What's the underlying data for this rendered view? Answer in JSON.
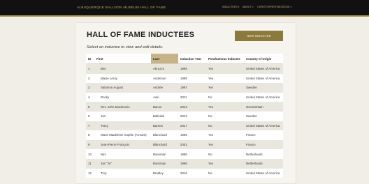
{
  "nav": {
    "brand": "ALBUQUERQUE BALLOON MUSEUM HALL OF FAME",
    "menus": [
      "INDUCTEES",
      "ABOUT",
      "CHRISTOPHER BELROSE"
    ]
  },
  "page": {
    "title": "HALL OF FAME INDUCTEES",
    "new_button": "NEW INDUCTEE",
    "hint": "Select an inductee to view and edit details."
  },
  "table": {
    "columns": [
      "ID",
      "First",
      "Last",
      "Induction Year",
      "Posthumous Inductee",
      "Country of Origin"
    ],
    "sorted_column": "Last",
    "rows": [
      [
        "1",
        "Ben",
        "Abruzzo",
        "1995",
        "Yes",
        "United States of America"
      ],
      [
        "2",
        "Maxie Leroy",
        "Anderson",
        "1995",
        "Yes",
        "United States of America"
      ],
      [
        "3",
        "Salomon August",
        "Andrée",
        "1997",
        "Yes",
        "Sweden"
      ],
      [
        "4",
        "Rocky",
        "Aoki",
        "2011",
        "No",
        "United States of America"
      ],
      [
        "5",
        "Rev. John Mackenzie",
        "Bacon",
        "2013",
        "Yes",
        "Great Britain"
      ],
      [
        "6",
        "Jan",
        "Balledal",
        "2013",
        "No",
        "Sweden"
      ],
      [
        "7",
        "Tracy",
        "Barnes",
        "2017",
        "No",
        "United States of America"
      ],
      [
        "8",
        "Marie Madeleine Sophie (Armant)",
        "Blanchard",
        "1995",
        "Yes",
        "France"
      ],
      [
        "9",
        "Jean-Pierre François",
        "Blanchard",
        "2001",
        "Yes",
        "France"
      ],
      [
        "10",
        "Nini",
        "Boesman",
        "1996",
        "No",
        "Netherlands"
      ],
      [
        "11",
        "Jan \"Jo\"",
        "Boesman",
        "1996",
        "Yes",
        "Netherlands"
      ],
      [
        "12",
        "Troy",
        "Bradley",
        "2016",
        "No",
        "United States of America"
      ]
    ]
  }
}
